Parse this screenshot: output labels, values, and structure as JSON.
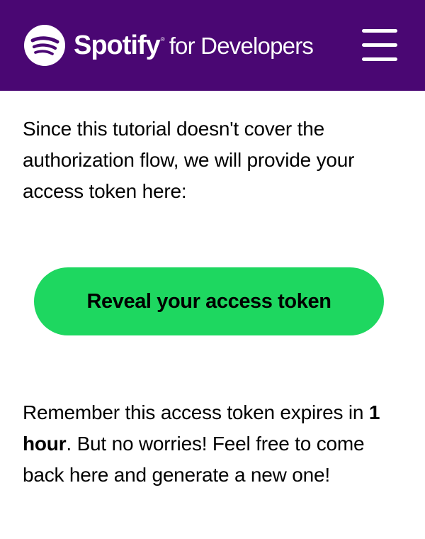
{
  "header": {
    "brand_name": "Spotify",
    "brand_mark": "®",
    "brand_sub": "for Developers",
    "logo_icon": "spotify-logo-icon",
    "menu_icon": "hamburger-menu-icon",
    "background_color": "#4a0773"
  },
  "content": {
    "intro_text": "Since this tutorial doesn't cover the authorization flow, we will provide your access token here:",
    "reveal_button_label": "Reveal your access token",
    "reminder_prefix": "Remember this access token expires in ",
    "reminder_bold": "1 hour",
    "reminder_suffix": ". But no worries! Feel free to come back here and generate a new one!",
    "accent_color": "#1ed760"
  }
}
